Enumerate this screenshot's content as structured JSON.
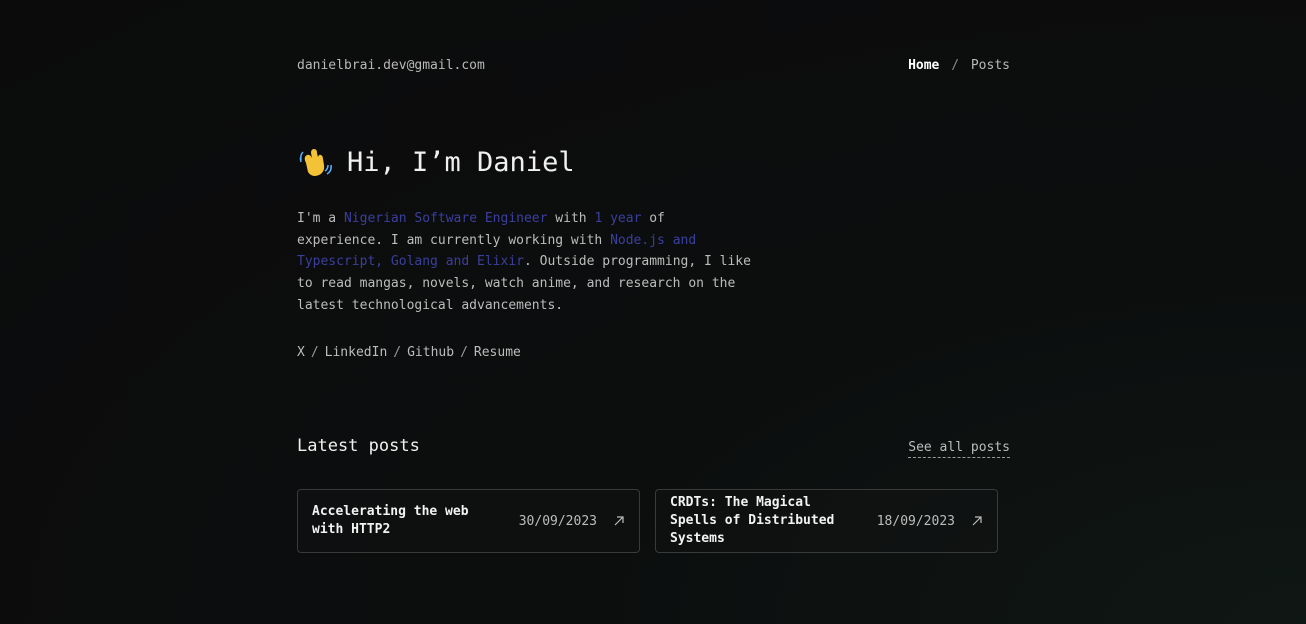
{
  "header": {
    "email": "danielbrai.dev@gmail.com",
    "nav": {
      "home": "Home",
      "separator": "/",
      "posts": "Posts"
    }
  },
  "hero": {
    "icon": "waving-hand-icon",
    "title": "Hi, I’m Daniel"
  },
  "bio": {
    "t1": "I'm a ",
    "h1": "Nigerian Software Engineer",
    "t2": " with ",
    "h2": "1 year",
    "t3": " of experience. I am currently working with ",
    "h3": "Node.js and Typescript, Golang and Elixir",
    "t4": ". Outside programming, I like to read mangas, novels, watch anime, and research on the latest technological advancements."
  },
  "socials": [
    "X",
    "LinkedIn",
    "Github",
    "Resume"
  ],
  "posts": {
    "title": "Latest posts",
    "see_all": "See all posts",
    "items": [
      {
        "title": "Accelerating the web with HTTP2",
        "date": "30/09/2023",
        "icon": "arrow-up-right-icon"
      },
      {
        "title": "CRDTs: The Magical Spells of Distributed Systems",
        "date": "18/09/2023",
        "icon": "arrow-up-right-icon"
      }
    ]
  },
  "colors": {
    "highlight": "#3b3f9e",
    "text": "#bcbcbc",
    "heading": "#f0f0f0",
    "border": "#3a3a3a"
  }
}
